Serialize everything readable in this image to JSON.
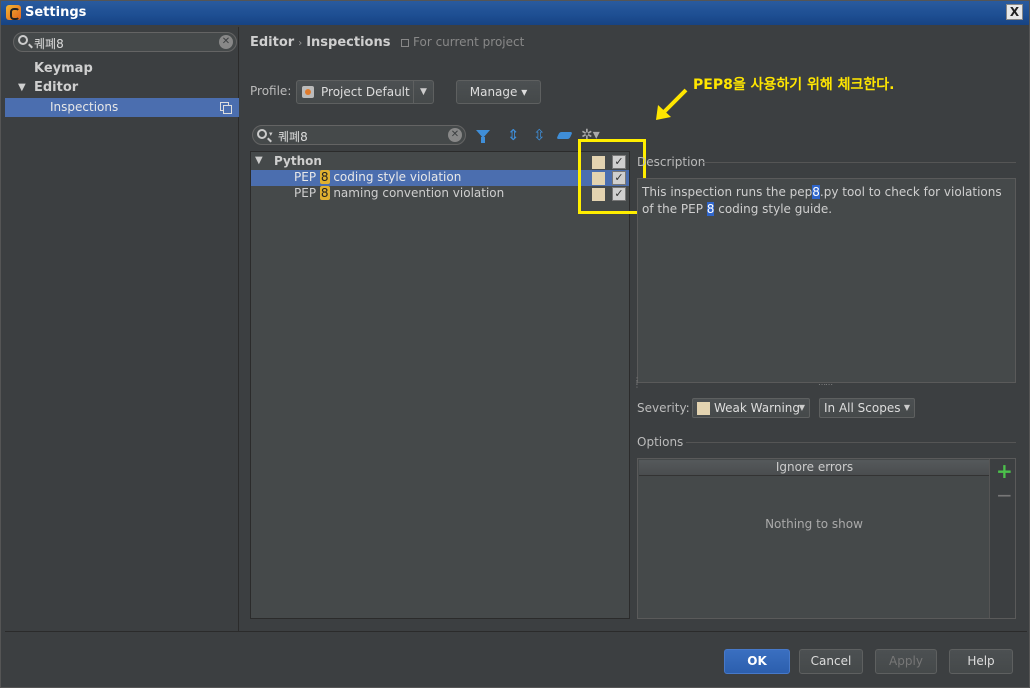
{
  "window": {
    "title": "Settings",
    "close": "X"
  },
  "sidebar": {
    "search_value": "퀘폐8",
    "items": [
      {
        "label": "Keymap"
      },
      {
        "label": "Editor"
      },
      {
        "label": "Inspections"
      }
    ]
  },
  "breadcrumb": {
    "part1": "Editor",
    "part2": "Inspections",
    "scope": "For current project"
  },
  "profile": {
    "label": "Profile:",
    "value": "Project Default",
    "manage": "Manage"
  },
  "callout": "PEP8을 사용하기 위해 체크한다.",
  "filter": {
    "value": "퀘폐8"
  },
  "inspections": {
    "group": "Python",
    "rows": [
      {
        "prefix": "PEP ",
        "match": "8",
        "suffix": " coding style violation",
        "checked": true
      },
      {
        "prefix": "PEP ",
        "match": "8",
        "suffix": " naming convention violation",
        "checked": true
      }
    ]
  },
  "description": {
    "label": "Description",
    "t1": "This inspection runs the pep",
    "m1": "8",
    "t2": ".py tool to check for violations of the PEP ",
    "m2": "8",
    "t3": " coding style guide."
  },
  "severity": {
    "label": "Severity:",
    "value": "Weak Warning",
    "scope": "In All Scopes"
  },
  "options": {
    "label": "Options",
    "header": "Ignore errors",
    "empty": "Nothing to show"
  },
  "buttons": {
    "ok": "OK",
    "cancel": "Cancel",
    "apply": "Apply",
    "help": "Help"
  },
  "colors": {
    "accent": "#4b6eaf",
    "highlight": "#ffee00"
  }
}
